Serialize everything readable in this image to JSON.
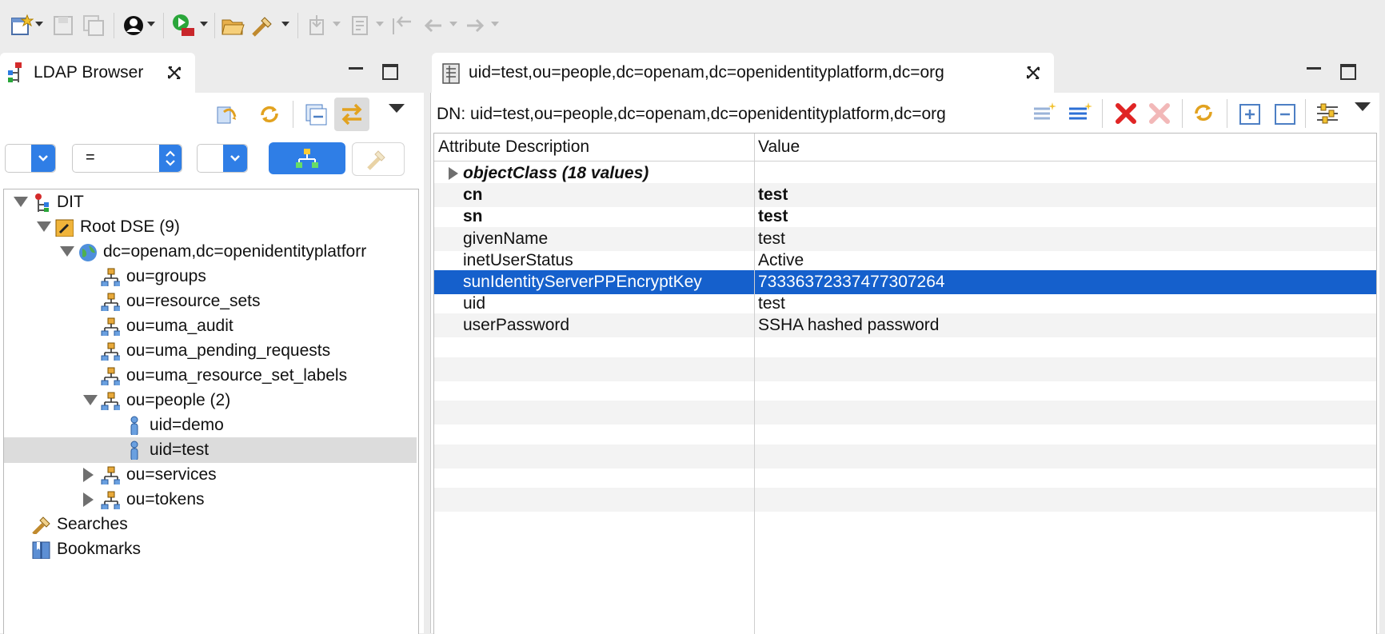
{
  "left_panel": {
    "tab_title": "LDAP Browser",
    "filter": {
      "attribute_select": "",
      "operator_select": "=",
      "value_select": ""
    },
    "tree": [
      {
        "label": "DIT",
        "icon": "dit-icon",
        "state": "open"
      },
      {
        "label": "Root DSE (9)",
        "icon": "root-dse-icon",
        "state": "open"
      },
      {
        "label": "dc=openam,dc=openidentityplatforr",
        "icon": "globe-icon",
        "state": "open"
      },
      {
        "label": "ou=groups",
        "icon": "org-unit-icon",
        "state": "leaf"
      },
      {
        "label": "ou=resource_sets",
        "icon": "org-unit-icon",
        "state": "leaf"
      },
      {
        "label": "ou=uma_audit",
        "icon": "org-unit-icon",
        "state": "leaf"
      },
      {
        "label": "ou=uma_pending_requests",
        "icon": "org-unit-icon",
        "state": "leaf"
      },
      {
        "label": "ou=uma_resource_set_labels",
        "icon": "org-unit-icon",
        "state": "leaf"
      },
      {
        "label": "ou=people (2)",
        "icon": "org-unit-icon",
        "state": "open"
      },
      {
        "label": "uid=demo",
        "icon": "person-icon",
        "state": "leaf"
      },
      {
        "label": "uid=test",
        "icon": "person-icon",
        "state": "leaf",
        "selected": true
      },
      {
        "label": "ou=services",
        "icon": "org-unit-icon",
        "state": "closed"
      },
      {
        "label": "ou=tokens",
        "icon": "org-unit-icon",
        "state": "closed"
      },
      {
        "label": "Searches",
        "icon": "searches-icon",
        "state": "leaf"
      },
      {
        "label": "Bookmarks",
        "icon": "bookmarks-icon",
        "state": "leaf"
      }
    ]
  },
  "editor": {
    "tab_title": "uid=test,ou=people,dc=openam,dc=openidentityplatform,dc=org",
    "dn_label": "DN: uid=test,ou=people,dc=openam,dc=openidentityplatform,dc=org",
    "columns": [
      "Attribute Description",
      "Value"
    ],
    "rows": [
      {
        "attribute": "objectClass (18 values)",
        "value": "",
        "style": "bold-italic",
        "expandable": true
      },
      {
        "attribute": "cn",
        "value": "test",
        "style": "bold"
      },
      {
        "attribute": "sn",
        "value": "test",
        "style": "bold"
      },
      {
        "attribute": "givenName",
        "value": "test",
        "style": "normal"
      },
      {
        "attribute": "inetUserStatus",
        "value": "Active",
        "style": "normal"
      },
      {
        "attribute": "sunIdentityServerPPEncryptKey",
        "value": "73336372337477307264",
        "style": "normal",
        "selected": true
      },
      {
        "attribute": "uid",
        "value": "test",
        "style": "normal"
      },
      {
        "attribute": "userPassword",
        "value": "SSHA hashed password",
        "style": "normal"
      }
    ]
  },
  "colors": {
    "selection": "#1560cc",
    "tree_selection": "#dcdcdc",
    "delete_red": "#e02424",
    "accent_blue": "#2f7ee6"
  }
}
